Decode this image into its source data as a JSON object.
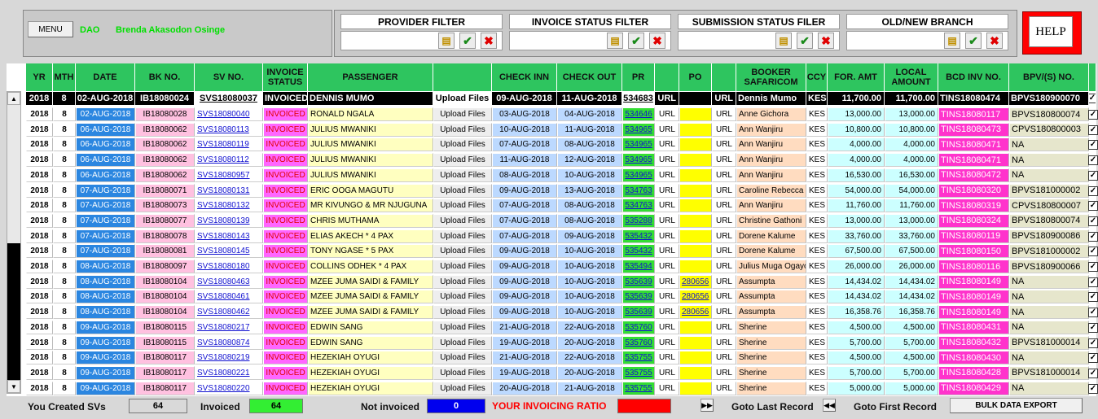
{
  "top": {
    "menu_label": "MENU",
    "user_code": "DAO",
    "user_name": "Brenda Akasodon Osinge",
    "help_label": "HELP"
  },
  "filters": [
    {
      "label": "PROVIDER FILTER"
    },
    {
      "label": "INVOICE STATUS FILTER"
    },
    {
      "label": "SUBMISSION STATUS FILER"
    },
    {
      "label": "OLD/NEW BRANCH"
    }
  ],
  "columns": [
    "YR",
    "MTH",
    "DATE",
    "BK NO.",
    "SV NO.",
    "INVOICE STATUS",
    "PASSENGER",
    "",
    "CHECK INN",
    "CHECK OUT",
    "PR",
    "",
    "PO",
    "",
    "BOOKER SAFARICOM",
    "CCY",
    "FOR. AMT",
    "LOCAL AMOUNT",
    "BCD INV NO.",
    "BPV/(S) NO.",
    ""
  ],
  "current": {
    "yr": "2018",
    "mth": "8",
    "date": "02-AUG-2018",
    "bk": "IB18080024",
    "sv": "SVS18080037",
    "status": "INVOICED",
    "pax": "DENNIS MUMO",
    "upload": "Upload Files",
    "cin": "09-AUG-2018",
    "cout": "11-AUG-2018",
    "pr": "534683",
    "prurl": "URL",
    "po": "",
    "pourl": "URL",
    "booker": "Dennis Mumo",
    "ccy": "KES",
    "famt": "11,700.00",
    "lamt": "11,700.00",
    "bcd": "TINS18080474",
    "bpv": "BPVS180900070",
    "chk": "✓"
  },
  "rows": [
    [
      "2018",
      "8",
      "02-AUG-2018",
      "IB18080028",
      "SVS18080040",
      "INVOICED",
      "RONALD NGALA",
      "Upload Files",
      "03-AUG-2018",
      "04-AUG-2018",
      "534646",
      "URL",
      "",
      "URL",
      "Anne Gichora",
      "KES",
      "13,000.00",
      "13,000.00",
      "TINS18080117",
      "BPVS180800074"
    ],
    [
      "2018",
      "8",
      "06-AUG-2018",
      "IB18080062",
      "SVS18080113",
      "INVOICED",
      "JULIUS MWANIKI",
      "Upload Files",
      "10-AUG-2018",
      "11-AUG-2018",
      "534965",
      "URL",
      "",
      "URL",
      "Ann Wanjiru",
      "KES",
      "10,800.00",
      "10,800.00",
      "TINS18080473",
      "CPVS180800003"
    ],
    [
      "2018",
      "8",
      "06-AUG-2018",
      "IB18080062",
      "SVS18080119",
      "INVOICED",
      "JULIUS MWANIKI",
      "Upload Files",
      "07-AUG-2018",
      "08-AUG-2018",
      "534965",
      "URL",
      "",
      "URL",
      "Ann Wanjiru",
      "KES",
      "4,000.00",
      "4,000.00",
      "TINS18080471",
      "NA"
    ],
    [
      "2018",
      "8",
      "06-AUG-2018",
      "IB18080062",
      "SVS18080112",
      "INVOICED",
      "JULIUS MWANIKI",
      "Upload Files",
      "11-AUG-2018",
      "12-AUG-2018",
      "534965",
      "URL",
      "",
      "URL",
      "Ann Wanjiru",
      "KES",
      "4,000.00",
      "4,000.00",
      "TINS18080471",
      "NA"
    ],
    [
      "2018",
      "8",
      "06-AUG-2018",
      "IB18080062",
      "SVS18080957",
      "INVOICED",
      "JULIUS MWANIKI",
      "Upload Files",
      "08-AUG-2018",
      "10-AUG-2018",
      "534965",
      "URL",
      "",
      "URL",
      "Ann Wanjiru",
      "KES",
      "16,530.00",
      "16,530.00",
      "TINS18080472",
      "NA"
    ],
    [
      "2018",
      "8",
      "07-AUG-2018",
      "IB18080071",
      "SVS18080131",
      "INVOICED",
      "ERIC OOGA MAGUTU",
      "Upload Files",
      "09-AUG-2018",
      "13-AUG-2018",
      "534763",
      "URL",
      "",
      "URL",
      "Caroline Rebecca W.",
      "KES",
      "54,000.00",
      "54,000.00",
      "TINS18080320",
      "BPVS181000002"
    ],
    [
      "2018",
      "8",
      "07-AUG-2018",
      "IB18080073",
      "SVS18080132",
      "INVOICED",
      "MR KIVUNGO & MR NJUGUNA",
      "Upload Files",
      "07-AUG-2018",
      "08-AUG-2018",
      "534763",
      "URL",
      "",
      "URL",
      "Ann Wanjiru",
      "KES",
      "11,760.00",
      "11,760.00",
      "TINS18080319",
      "CPVS180800007"
    ],
    [
      "2018",
      "8",
      "07-AUG-2018",
      "IB18080077",
      "SVS18080139",
      "INVOICED",
      "CHRIS MUTHAMA",
      "Upload Files",
      "07-AUG-2018",
      "08-AUG-2018",
      "535288",
      "URL",
      "",
      "URL",
      "Christine Gathoni",
      "KES",
      "13,000.00",
      "13,000.00",
      "TINS18080324",
      "BPVS180800074"
    ],
    [
      "2018",
      "8",
      "07-AUG-2018",
      "IB18080078",
      "SVS18080143",
      "INVOICED",
      "ELIAS AKECH * 4 PAX",
      "Upload Files",
      "07-AUG-2018",
      "09-AUG-2018",
      "535432",
      "URL",
      "",
      "URL",
      "Dorene Kalume",
      "KES",
      "33,760.00",
      "33,760.00",
      "TINS18080119",
      "BPVS180900086"
    ],
    [
      "2018",
      "8",
      "07-AUG-2018",
      "IB18080081",
      "SVS18080145",
      "INVOICED",
      "TONY NGASE * 5 PAX",
      "Upload Files",
      "09-AUG-2018",
      "10-AUG-2018",
      "535432",
      "URL",
      "",
      "URL",
      "Dorene Kalume",
      "KES",
      "67,500.00",
      "67,500.00",
      "TINS18080150",
      "BPVS181000002"
    ],
    [
      "2018",
      "8",
      "08-AUG-2018",
      "IB18080097",
      "SVS18080180",
      "INVOICED",
      "COLLINS ODHEK * 4 PAX",
      "Upload Files",
      "09-AUG-2018",
      "10-AUG-2018",
      "535494",
      "URL",
      "",
      "URL",
      "Julius Muga Ogayo",
      "KES",
      "26,000.00",
      "26,000.00",
      "TINS18080116",
      "BPVS180900066"
    ],
    [
      "2018",
      "8",
      "08-AUG-2018",
      "IB18080104",
      "SVS18080463",
      "INVOICED",
      "MZEE JUMA SAIDI & FAMILY",
      "Upload Files",
      "09-AUG-2018",
      "10-AUG-2018",
      "535639",
      "URL",
      "280656",
      "URL",
      "Assumpta",
      "KES",
      "14,434.02",
      "14,434.02",
      "TINS18080149",
      "NA"
    ],
    [
      "2018",
      "8",
      "08-AUG-2018",
      "IB18080104",
      "SVS18080461",
      "INVOICED",
      "MZEE JUMA SAIDI & FAMILY",
      "Upload Files",
      "09-AUG-2018",
      "10-AUG-2018",
      "535639",
      "URL",
      "280656",
      "URL",
      "Assumpta",
      "KES",
      "14,434.02",
      "14,434.02",
      "TINS18080149",
      "NA"
    ],
    [
      "2018",
      "8",
      "08-AUG-2018",
      "IB18080104",
      "SVS18080462",
      "INVOICED",
      "MZEE JUMA SAIDI & FAMILY",
      "Upload Files",
      "09-AUG-2018",
      "10-AUG-2018",
      "535639",
      "URL",
      "280656",
      "URL",
      "Assumpta",
      "KES",
      "16,358.76",
      "16,358.76",
      "TINS18080149",
      "NA"
    ],
    [
      "2018",
      "8",
      "09-AUG-2018",
      "IB18080115",
      "SVS18080217",
      "INVOICED",
      "EDWIN SANG",
      "Upload Files",
      "21-AUG-2018",
      "22-AUG-2018",
      "535760",
      "URL",
      "",
      "URL",
      "Sherine",
      "KES",
      "4,500.00",
      "4,500.00",
      "TINS18080431",
      "NA"
    ],
    [
      "2018",
      "8",
      "09-AUG-2018",
      "IB18080115",
      "SVS18080874",
      "INVOICED",
      "EDWIN SANG",
      "Upload Files",
      "19-AUG-2018",
      "20-AUG-2018",
      "535760",
      "URL",
      "",
      "URL",
      "Sherine",
      "KES",
      "5,700.00",
      "5,700.00",
      "TINS18080432",
      "BPVS181000014"
    ],
    [
      "2018",
      "8",
      "09-AUG-2018",
      "IB18080117",
      "SVS18080219",
      "INVOICED",
      "HEZEKIAH OYUGI",
      "Upload Files",
      "21-AUG-2018",
      "22-AUG-2018",
      "535755",
      "URL",
      "",
      "URL",
      "Sherine",
      "KES",
      "4,500.00",
      "4,500.00",
      "TINS18080430",
      "NA"
    ],
    [
      "2018",
      "8",
      "09-AUG-2018",
      "IB18080117",
      "SVS18080221",
      "INVOICED",
      "HEZEKIAH OYUGI",
      "Upload Files",
      "19-AUG-2018",
      "20-AUG-2018",
      "535755",
      "URL",
      "",
      "URL",
      "Sherine",
      "KES",
      "5,700.00",
      "5,700.00",
      "TINS18080428",
      "BPVS181000014"
    ],
    [
      "2018",
      "8",
      "09-AUG-2018",
      "IB18080117",
      "SVS18080220",
      "INVOICED",
      "HEZEKIAH OYUGI",
      "Upload Files",
      "20-AUG-2018",
      "21-AUG-2018",
      "535755",
      "URL",
      "",
      "URL",
      "Sherine",
      "KES",
      "5,000.00",
      "5,000.00",
      "TINS18080429",
      "NA"
    ]
  ],
  "footer": {
    "created_label": "You Created SVs",
    "created_count": "64",
    "invoiced_label": "Invoiced",
    "invoiced_count": "64",
    "not_invoiced_label": "Not invoiced",
    "not_invoiced_count": "0",
    "ratio_label": "YOUR INVOICING RATIO",
    "last_label": "Goto Last Record",
    "first_label": "Goto First Record",
    "export_label": "BULK DATA EXPORT"
  },
  "colors": {
    "header": "#2ec55f",
    "invoiced": "#ff66ff",
    "pr": "#33dd33",
    "po": "#ffff00",
    "tins": "#ff33cc",
    "ratio": "#ff0000",
    "not_invoiced_box": "#0000ee",
    "invoiced_box": "#33ee33"
  }
}
